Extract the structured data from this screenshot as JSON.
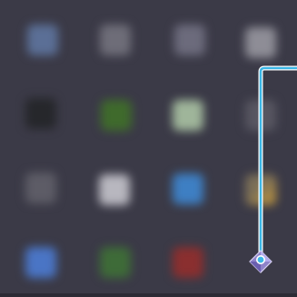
{
  "app_grid": {
    "tiles": [
      {
        "name": "app-icon-blue-globe",
        "color": "#5b6f96",
        "accent": "#6f86b3"
      },
      {
        "name": "app-icon-gray-doc",
        "color": "#6e6d78",
        "accent": "#7b7a85"
      },
      {
        "name": "app-icon-gray-tool",
        "color": "#6c6b7c",
        "accent": "#7f7e8d"
      },
      {
        "name": "app-icon-silver-box",
        "color": "#8e8d96",
        "accent": "#a1a0a8"
      },
      {
        "name": "app-icon-dark-terminal",
        "color": "#26272b",
        "accent": "#33343a"
      },
      {
        "name": "app-icon-green-leaf",
        "color": "#3f6a2c",
        "accent": "#5b8b3b"
      },
      {
        "name": "app-icon-light-green",
        "color": "#9fb59a",
        "accent": "#c3d2bf"
      },
      {
        "name": "app-icon-faded-gray",
        "color": "#575661",
        "accent": "#666571"
      },
      {
        "name": "app-icon-gray-disk",
        "color": "#5d5c66",
        "accent": "#6b6a74"
      },
      {
        "name": "app-icon-white-panel",
        "color": "#b8b7bf",
        "accent": "#d2d1d8"
      },
      {
        "name": "app-icon-blue-mail",
        "color": "#3e7fc3",
        "accent": "#5b98d6"
      },
      {
        "name": "app-icon-amber-folder",
        "color": "#7b6f58",
        "accent": "#c79a3a"
      },
      {
        "name": "app-icon-blue-square",
        "color": "#4a75c5",
        "accent": "#5e89d8"
      },
      {
        "name": "app-icon-green-map",
        "color": "#3e6b38",
        "accent": "#5a8c44"
      },
      {
        "name": "app-icon-red-record",
        "color": "#8a2f2f",
        "accent": "#b03a35"
      },
      {
        "name": "launcher-icon",
        "color": "#7a6bd6",
        "accent": "#9b8ef0"
      }
    ]
  },
  "highlight": {
    "color": "#3ab6e6",
    "target": "launcher-icon"
  }
}
